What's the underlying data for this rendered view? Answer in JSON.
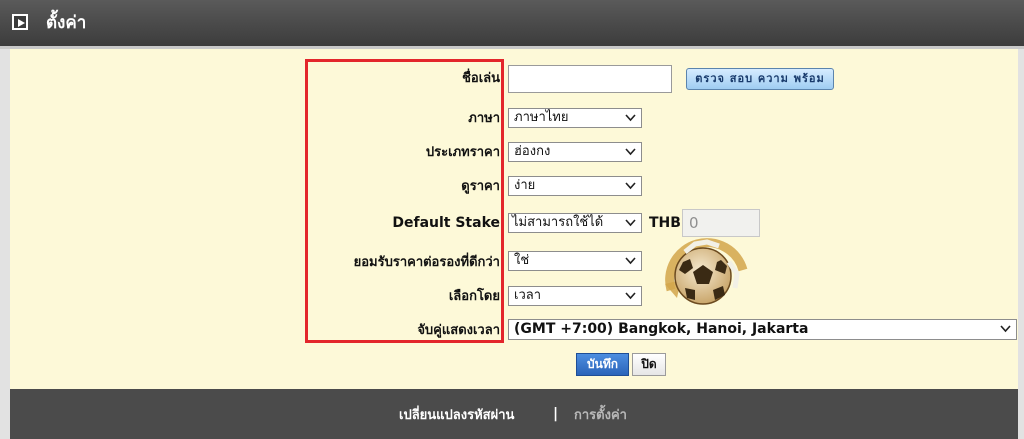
{
  "header": {
    "title": "ตั้งค่า"
  },
  "form": {
    "nickname": {
      "label": "ชื่อเล่น",
      "value": "",
      "check_button": "ตรวจ สอบ ความ พร้อม"
    },
    "language": {
      "label": "ภาษา",
      "value": "ภาษาไทย"
    },
    "odds_type": {
      "label": "ประเภทราคา",
      "value": "ฮ่องกง"
    },
    "odds_view": {
      "label": "ดูราคา",
      "value": "ง่าย"
    },
    "default_stake": {
      "label": "Default Stake",
      "value": "ไม่สามารถใช้ได้",
      "currency": "THB",
      "amount": "0"
    },
    "accept_better_odds": {
      "label": "ยอมรับราคาต่อรองที่ดีกว่า",
      "value": "ใช่"
    },
    "sort_by": {
      "label": "เลือกโดย",
      "value": "เวลา"
    },
    "timezone": {
      "label": "จับคู่แสดงเวลา",
      "value": "(GMT +7:00) Bangkok, Hanoi, Jakarta"
    },
    "save_button": "บันทึก",
    "close_button": "ปิด"
  },
  "footer": {
    "change_password": "เปลี่ยนแปลงรหัสผ่าน",
    "separator": "|",
    "settings": "การตั้งค่า"
  },
  "colors": {
    "highlight_box": "#e3262b",
    "panel_background": "#fdf9d8",
    "save_button": "#2a64b9",
    "footer_background": "#4b4b4b"
  }
}
